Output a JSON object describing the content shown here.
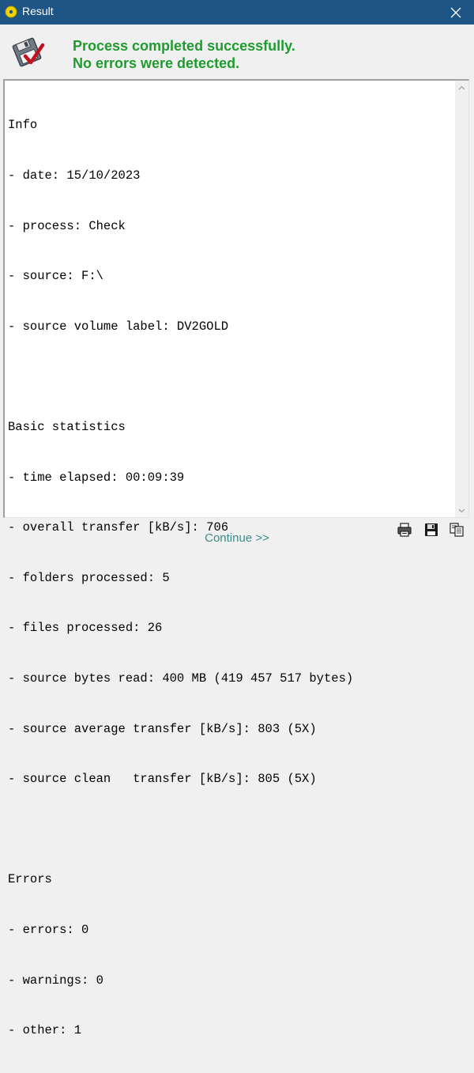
{
  "window": {
    "title": "Result",
    "title_icon": "disc-icon",
    "close_icon": "close-icon",
    "titlebar_color": "#1f5585"
  },
  "header": {
    "icon": "floppy-check-icon",
    "line1": "Process completed successfully.",
    "line2": "No errors were detected.",
    "color": "#1f9b2f"
  },
  "log": {
    "lines": [
      "Info",
      "- date: 15/10/2023",
      "- process: Check",
      "- source: F:\\",
      "- source volume label: DV2GOLD",
      "",
      "Basic statistics",
      "- time elapsed: 00:09:39",
      "- overall transfer [kB/s]: 706",
      "- folders processed: 5",
      "- files processed: 26",
      "- source bytes read: 400 MB (419 457 517 bytes)",
      "- source average transfer [kB/s]: 803 (5X)",
      "- source clean   transfer [kB/s]: 805 (5X)",
      "",
      "Errors",
      "- errors: 0",
      "- warnings: 0",
      "- other: 1"
    ]
  },
  "footer": {
    "continue_label": "Continue >>",
    "icons": [
      "print-icon",
      "save-icon",
      "copy-icon"
    ]
  }
}
